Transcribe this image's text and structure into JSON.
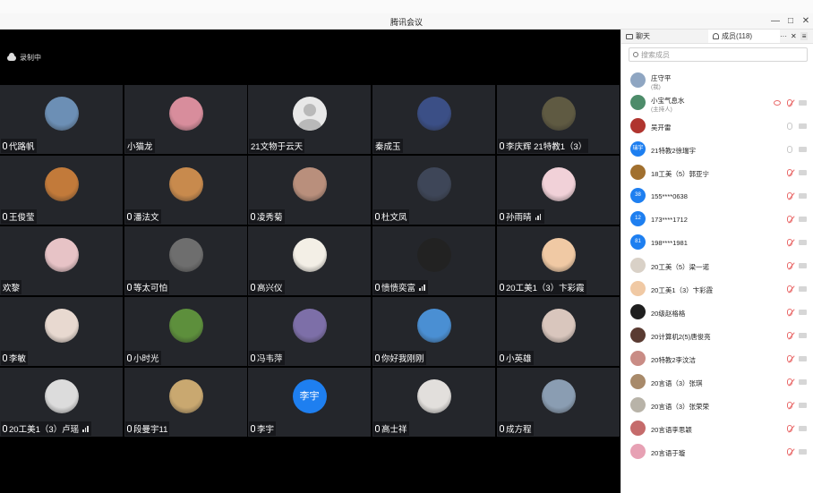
{
  "window": {
    "title": "腾讯会议",
    "min": "—",
    "max": "□",
    "close": "✕"
  },
  "recording": {
    "label": "录制中"
  },
  "grid": [
    {
      "name": "代路帆",
      "mic": true,
      "avatar": "#6c8fb5"
    },
    {
      "name": "小猫龙",
      "mic": false,
      "avatar": "#d88d9c"
    },
    {
      "name": "21文物于云天",
      "mic": false,
      "avatar": "default"
    },
    {
      "name": "秦成玉",
      "mic": false,
      "avatar": "#3b4f86"
    },
    {
      "name": "李庆辉 21特教1（3）",
      "mic": true,
      "avatar": "#5f5a42"
    },
    {
      "name": "王俊莹",
      "mic": true,
      "avatar": "#c27a3a"
    },
    {
      "name": "潘法文",
      "mic": true,
      "avatar": "#c88a4d"
    },
    {
      "name": "凌秀菊",
      "mic": true,
      "avatar": "#b98f7c"
    },
    {
      "name": "杜文凤",
      "mic": true,
      "avatar": "#3e4658"
    },
    {
      "name": "孙雨晴",
      "mic": true,
      "bars": true,
      "avatar": "#f1d1d8"
    },
    {
      "name": "欢黎",
      "mic": false,
      "avatar": "#e7c3c6"
    },
    {
      "name": "等太可怕",
      "mic": true,
      "avatar": "#6e6e6e"
    },
    {
      "name": "高兴仪",
      "mic": true,
      "avatar": "#f3efe6"
    },
    {
      "name": "愦愦奕富",
      "mic": true,
      "bars": true,
      "avatar": "#222222"
    },
    {
      "name": "20工美1（3）卞彩霞",
      "mic": true,
      "avatar": "#f0c9a4"
    },
    {
      "name": "李敏",
      "mic": true,
      "avatar": "#e8d9d0"
    },
    {
      "name": "小时光",
      "mic": true,
      "avatar": "#5d8f3c"
    },
    {
      "name": "冯韦萍",
      "mic": true,
      "avatar": "#7d6fa8"
    },
    {
      "name": "你好我刚刚",
      "mic": true,
      "avatar": "#4a8fd3"
    },
    {
      "name": "小英雄",
      "mic": true,
      "avatar": "#d9c6bd"
    },
    {
      "name": "20工美1（3）卢瑶",
      "mic": true,
      "bars": true,
      "avatar": "#dcdcdc"
    },
    {
      "name": "段曼宇11",
      "mic": true,
      "avatar": "#c9a870"
    },
    {
      "name": "李宇",
      "mic": true,
      "avatar": "text",
      "avatar_text": "李宇"
    },
    {
      "name": "高士祥",
      "mic": true,
      "avatar": "#e2dfdc"
    },
    {
      "name": "成方程",
      "mic": true,
      "avatar": "#8a9db2"
    }
  ],
  "panel": {
    "chat_tab": "聊天",
    "members_tab": "成员(118)",
    "more": "···",
    "close": "✕",
    "expand": "≡",
    "search_placeholder": "搜索成员",
    "members": [
      {
        "name": "庄守平",
        "sub": "(我)",
        "avatar": "#8fa6c2",
        "state": "none"
      },
      {
        "name": "小宝气息水",
        "sub": "(主持人)",
        "avatar": "#4d8c6a",
        "state": "host"
      },
      {
        "name": "吴开雷",
        "avatar": "#b0352f",
        "state": "gray"
      },
      {
        "name": "21特教2徐瑞宇",
        "avatar": "text",
        "avatar_text": "瑞宇",
        "state": "gray"
      },
      {
        "name": "18工美（5）郭亚宁",
        "avatar": "#a1702f",
        "state": "off"
      },
      {
        "name": "155****0638",
        "avatar": "text",
        "avatar_text": "38",
        "state": "off"
      },
      {
        "name": "173****1712",
        "avatar": "text",
        "avatar_text": "12",
        "state": "off"
      },
      {
        "name": "198****1981",
        "avatar": "text",
        "avatar_text": "81",
        "state": "off"
      },
      {
        "name": "20工美（5）梁一诺",
        "avatar": "#d9d1c7",
        "state": "off"
      },
      {
        "name": "20工美1（3）卞彩霞",
        "avatar": "#f0c9a4",
        "state": "off"
      },
      {
        "name": "20级赵格格",
        "avatar": "#1f1f1f",
        "state": "off"
      },
      {
        "name": "20计算机2(5)唐俊亮",
        "avatar": "#5a3b32",
        "state": "off"
      },
      {
        "name": "20特教2李汶洁",
        "avatar": "#c98c85",
        "state": "off"
      },
      {
        "name": "20言语（3）张琪",
        "avatar": "#a88a6a",
        "state": "off"
      },
      {
        "name": "20言语（3）张荣荣",
        "avatar": "#b8b3a8",
        "state": "off"
      },
      {
        "name": "20言语李思颖",
        "avatar": "#c56b6b",
        "state": "off"
      },
      {
        "name": "20言语于璇",
        "avatar": "#e7a1b4",
        "state": "off"
      }
    ]
  }
}
